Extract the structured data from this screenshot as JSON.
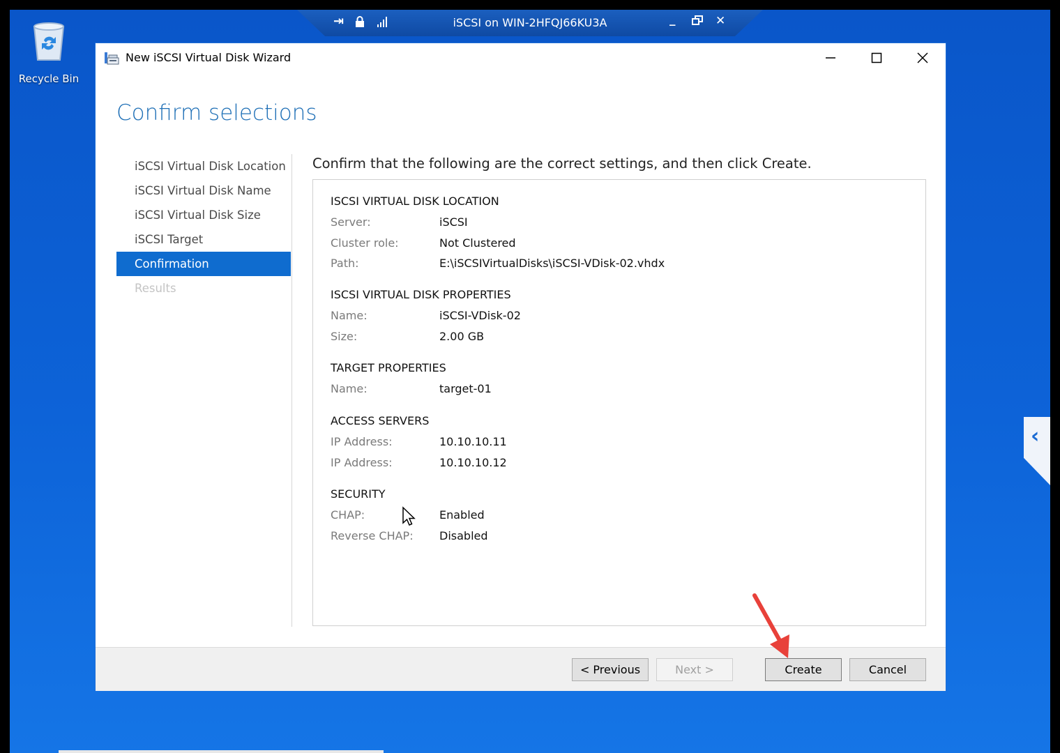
{
  "desktop": {
    "recycle_bin_label": "Recycle Bin"
  },
  "rdp_bar": {
    "title": "iSCSI on WIN-2HFQJ66KU3A",
    "pin_glyph": "⇥",
    "min_glyph": "_",
    "close_glyph": "✕"
  },
  "window": {
    "title": "New iSCSI Virtual Disk Wizard"
  },
  "page": {
    "heading": "Confirm selections",
    "instruction": "Confirm that the following are the correct settings, and then click Create."
  },
  "steps": [
    {
      "label": "iSCSI Virtual Disk Location",
      "state": "normal"
    },
    {
      "label": "iSCSI Virtual Disk Name",
      "state": "normal"
    },
    {
      "label": "iSCSI Virtual Disk Size",
      "state": "normal"
    },
    {
      "label": "iSCSI Target",
      "state": "normal"
    },
    {
      "label": "Confirmation",
      "state": "active"
    },
    {
      "label": "Results",
      "state": "disabled"
    }
  ],
  "summary": {
    "location": {
      "heading": "ISCSI VIRTUAL DISK LOCATION",
      "rows": [
        {
          "label": "Server:",
          "value": "iSCSI"
        },
        {
          "label": "Cluster role:",
          "value": "Not Clustered"
        },
        {
          "label": "Path:",
          "value": "E:\\iSCSIVirtualDisks\\iSCSI-VDisk-02.vhdx"
        }
      ]
    },
    "properties": {
      "heading": "ISCSI VIRTUAL DISK PROPERTIES",
      "rows": [
        {
          "label": "Name:",
          "value": "iSCSI-VDisk-02"
        },
        {
          "label": "Size:",
          "value": "2.00 GB"
        }
      ]
    },
    "target": {
      "heading": "TARGET PROPERTIES",
      "rows": [
        {
          "label": "Name:",
          "value": "target-01"
        }
      ]
    },
    "access": {
      "heading": "ACCESS SERVERS",
      "rows": [
        {
          "label": "IP Address:",
          "value": "10.10.10.11"
        },
        {
          "label": "IP Address:",
          "value": "10.10.10.12"
        }
      ]
    },
    "security": {
      "heading": "SECURITY",
      "rows": [
        {
          "label": "CHAP:",
          "value": "Enabled"
        },
        {
          "label": "Reverse CHAP:",
          "value": "Disabled"
        }
      ]
    }
  },
  "buttons": {
    "previous": "< Previous",
    "next": "Next >",
    "create": "Create",
    "cancel": "Cancel"
  },
  "colors": {
    "accent": "#0f6ccf",
    "heading": "#1e6fb6",
    "desktop": "#0d63d8",
    "annotation_arrow": "#e8413a"
  }
}
